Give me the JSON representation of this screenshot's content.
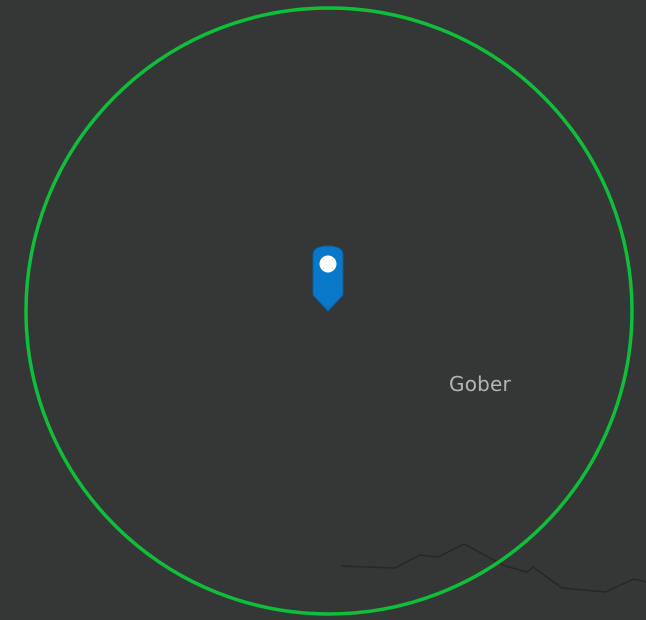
{
  "map": {
    "place_label": "Gober",
    "marker_icon": "map-pin-icon",
    "colors": {
      "background": "#353636",
      "radius_circle": "#0fbf3a",
      "marker_fill": "#0a78c8",
      "marker_dot": "#ffffff",
      "road": "#262727",
      "label": "#b4b4b4"
    }
  }
}
